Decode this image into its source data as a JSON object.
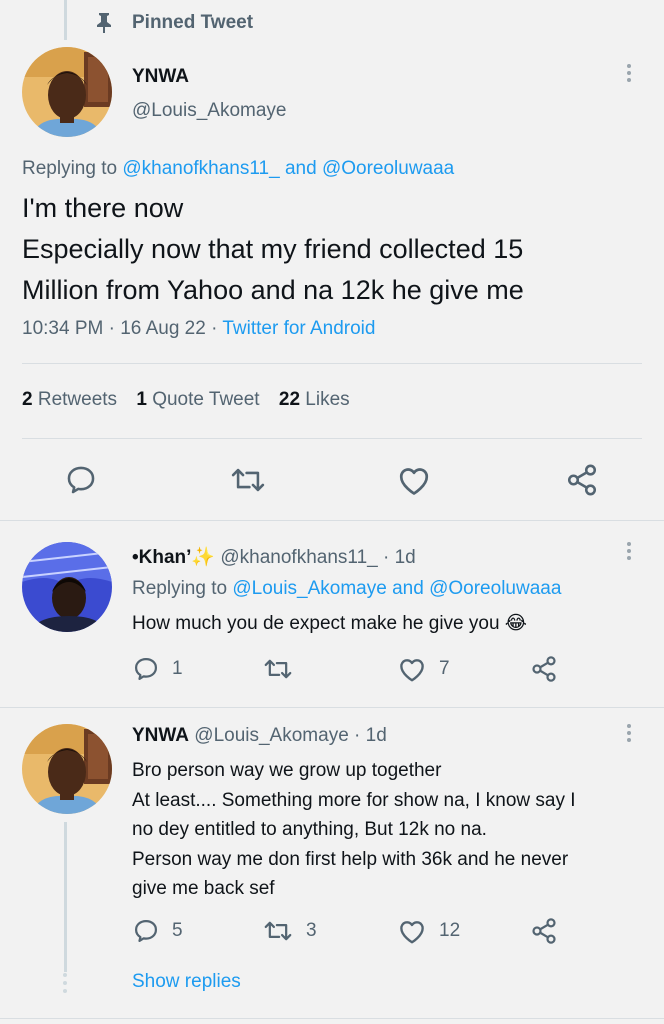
{
  "pinned": {
    "label": "Pinned Tweet"
  },
  "main_tweet": {
    "name": "YNWA",
    "handle": "@Louis_Akomaye",
    "replying_prefix": "Replying to",
    "replying_user1": "@khanofkhans11_",
    "replying_and": "and",
    "replying_user2": "@Ooreoluwaaa",
    "text_line1": "I'm there now",
    "text_line2": "Especially now that my friend collected 15",
    "text_line3": "Million from Yahoo and na 12k he give me",
    "time": "10:34 PM · 16 Aug 22 ·",
    "source": "Twitter for Android",
    "stats": {
      "retweets_count": "2",
      "retweets_label": "Retweets",
      "quotes_count": "1",
      "quotes_label": "Quote Tweet",
      "likes_count": "22",
      "likes_label": "Likes"
    }
  },
  "reply1": {
    "name": "•Khan’✨",
    "handle": "@khanofkhans11_",
    "time": "· 1d",
    "replying_prefix": "Replying to",
    "replying_user1": "@Louis_Akomaye",
    "replying_and": "and",
    "replying_user2": "@Ooreoluwaaa",
    "text": "How much you de expect make he give you 😂",
    "reply_count": "1",
    "retweet_count": "",
    "like_count": "7"
  },
  "reply2": {
    "name": "YNWA",
    "handle": "@Louis_Akomaye",
    "time": "· 1d",
    "text_line1": "Bro person way we grow up together",
    "text_line2": "At least.... Something more for show na, I know say I",
    "text_line3": "no dey entitled to anything, But 12k no na.",
    "text_line4": "Person way me don first help with 36k and he never",
    "text_line5": "give me back sef",
    "reply_count": "5",
    "retweet_count": "3",
    "like_count": "12"
  },
  "show_replies": "Show replies",
  "colors": {
    "accent": "#1d9bf0",
    "muted": "#536471",
    "background": "#f2f2f2"
  },
  "icons": [
    "pin-icon",
    "reply-icon",
    "retweet-icon",
    "like-icon",
    "share-icon",
    "more-icon"
  ]
}
